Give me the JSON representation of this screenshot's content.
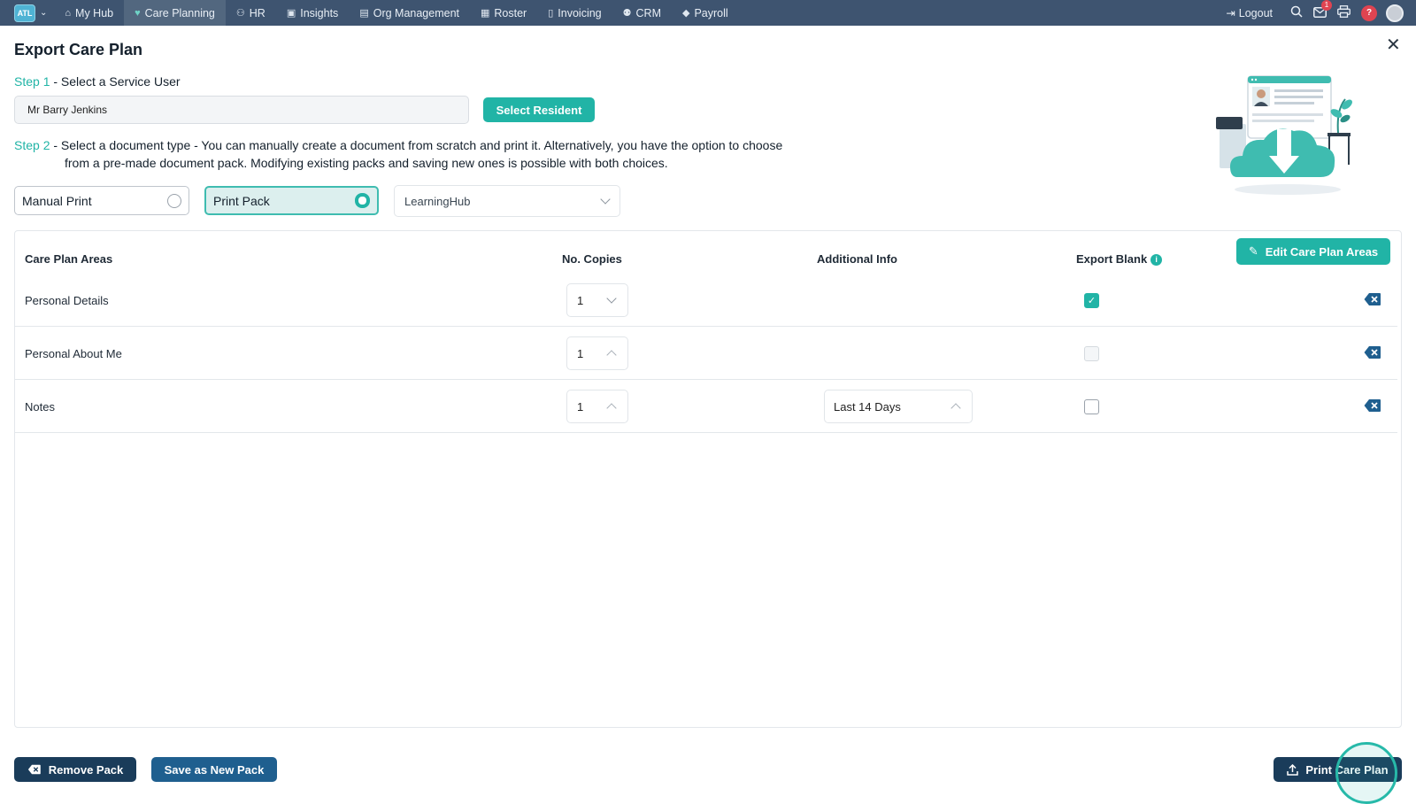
{
  "nav": {
    "brand": "ATL",
    "items": [
      {
        "label": "My Hub",
        "icon": "home-icon",
        "glyph": "⌂"
      },
      {
        "label": "Care Planning",
        "icon": "heart-icon",
        "glyph": "♥"
      },
      {
        "label": "HR",
        "icon": "people-icon",
        "glyph": "⚇"
      },
      {
        "label": "Insights",
        "icon": "chart-icon",
        "glyph": "▣"
      },
      {
        "label": "Org Management",
        "icon": "building-icon",
        "glyph": "▤"
      },
      {
        "label": "Roster",
        "icon": "calendar-icon",
        "glyph": "▦"
      },
      {
        "label": "Invoicing",
        "icon": "document-icon",
        "glyph": "▯"
      },
      {
        "label": "CRM",
        "icon": "contacts-icon",
        "glyph": "⚉"
      },
      {
        "label": "Payroll",
        "icon": "tag-icon",
        "glyph": "◆"
      }
    ],
    "active": "Care Planning",
    "logout": "Logout",
    "mail_badge": "1",
    "help": "?"
  },
  "page": {
    "title": "Export Care Plan",
    "step1_prefix": "Step 1",
    "step1_text": " - Select a Service User",
    "service_user": "Mr Barry Jenkins",
    "select_resident": "Select Resident",
    "step2_prefix": "Step 2",
    "step2_line1": " - Select a document type - You can manually create a document from scratch and print it. Alternatively, you have the option to choose",
    "step2_line2": "from a pre-made document pack. Modifying existing packs and saving new ones is possible with both choices.",
    "option_manual": "Manual Print",
    "option_pack": "Print Pack",
    "selected_option": "Print Pack",
    "pack_value": "LearningHub"
  },
  "table": {
    "headers": {
      "areas": "Care Plan Areas",
      "copies": "No. Copies",
      "additional": "Additional Info",
      "export_blank": "Export Blank"
    },
    "edit_button": "Edit Care Plan Areas",
    "rows": [
      {
        "area": "Personal Details",
        "copies": "1",
        "additional": "",
        "export_blank": true
      },
      {
        "area": "Personal About Me",
        "copies": "1",
        "additional": "",
        "export_blank": false
      },
      {
        "area": "Notes",
        "copies": "1",
        "additional": "Last 14 Days",
        "export_blank": false
      }
    ]
  },
  "footer": {
    "remove_pack": "Remove Pack",
    "save_pack": "Save as New Pack",
    "print": "Print Care Plan"
  },
  "colors": {
    "nav_bg": "#3e5470",
    "accent": "#21b4a6",
    "dark_button": "#1a3c5a",
    "save_button": "#1f5f8f"
  }
}
